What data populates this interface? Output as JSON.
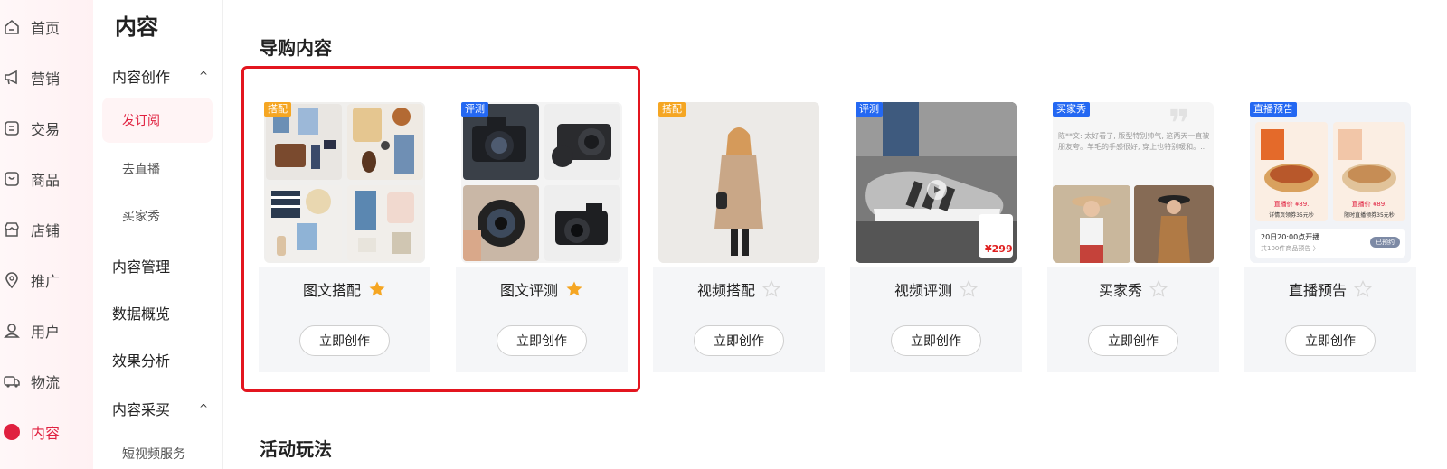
{
  "nav1": {
    "items": [
      {
        "label": "首页",
        "icon": "home-icon"
      },
      {
        "label": "营销",
        "icon": "megaphone-icon"
      },
      {
        "label": "交易",
        "icon": "receipt-icon"
      },
      {
        "label": "商品",
        "icon": "bag-icon"
      },
      {
        "label": "店铺",
        "icon": "store-icon"
      },
      {
        "label": "推广",
        "icon": "location-pin-icon"
      },
      {
        "label": "用户",
        "icon": "user-icon"
      },
      {
        "label": "物流",
        "icon": "truck-icon"
      },
      {
        "label": "内容",
        "icon": "hashtag-icon",
        "active": true
      }
    ],
    "accent": "#e0203f"
  },
  "nav2": {
    "title": "内容",
    "groups": [
      {
        "label": "内容创作",
        "caret": "^"
      },
      {
        "label": "内容管理"
      },
      {
        "label": "数据概览"
      },
      {
        "label": "效果分析"
      },
      {
        "label": "内容采买",
        "caret": "^"
      }
    ],
    "subitems": [
      "发订阅",
      "去直播",
      "买家秀",
      "短视频服务"
    ]
  },
  "main": {
    "section1_title": "导购内容",
    "section2_title": "活动玩法",
    "cards": [
      {
        "name": "图文搭配",
        "tag": "搭配",
        "tag_color": "orange",
        "starred": true,
        "button": "立即创作"
      },
      {
        "name": "图文评测",
        "tag": "评测",
        "tag_color": "blue",
        "starred": true,
        "button": "立即创作"
      },
      {
        "name": "视频搭配",
        "tag": "搭配",
        "tag_color": "orange",
        "starred": false,
        "button": "立即创作"
      },
      {
        "name": "视频评测",
        "tag": "评测",
        "tag_color": "blue",
        "starred": false,
        "button": "立即创作"
      },
      {
        "name": "买家秀",
        "tag": "买家秀",
        "tag_color": "blue",
        "starred": false,
        "button": "立即创作"
      },
      {
        "name": "直播预告",
        "tag": "直播预告",
        "tag_color": "blue",
        "starred": false,
        "button": "立即创作"
      }
    ],
    "video_price": "¥299",
    "buyer_review_text": "陈**文: 太好看了, 版型特别帅气, 这两天一直被朋友夸。羊毛的手感很好, 穿上也特别暖和。...",
    "live": {
      "price_tag_1": "直播价 ¥89.",
      "coupon_1": "详情页领券35元秒",
      "price_tag_2": "直播价 ¥89.",
      "coupon_2": "限时直播领券35元秒",
      "time_text": "20日20:00点开播",
      "sub_text": "共100件商品预告 〉",
      "reserved": "已预约"
    },
    "colors": {
      "star_on": "#f5a623",
      "star_off": "#dddddd",
      "highlight": "#e3151f"
    }
  }
}
